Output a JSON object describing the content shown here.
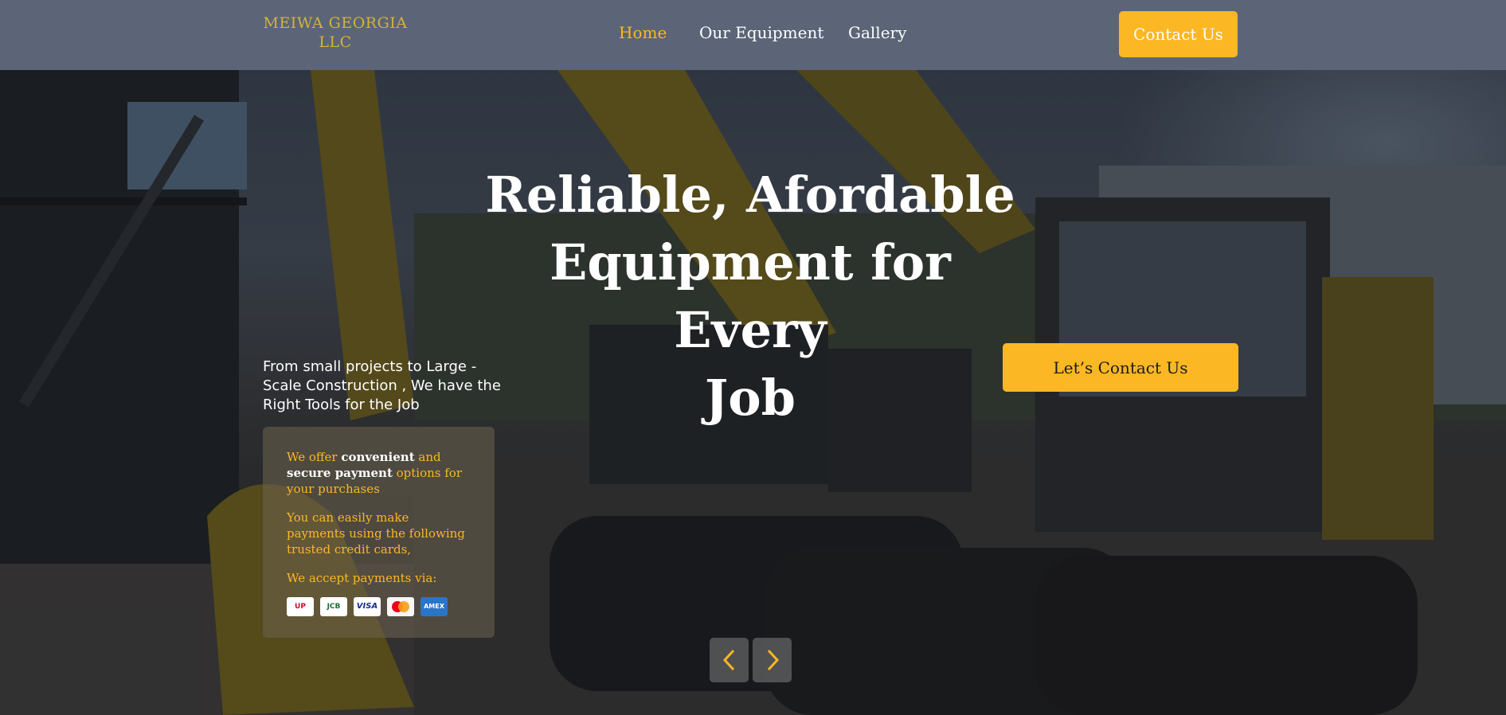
{
  "header": {
    "logo_line1": "MEIWA GEORGIA",
    "logo_line2": "LLC",
    "nav": [
      {
        "label": "Home",
        "active": true
      },
      {
        "label": "Our Equipment",
        "active": false
      },
      {
        "label": "Gallery",
        "active": false
      }
    ],
    "contact_button": "Contact Us"
  },
  "hero": {
    "title_line1": "Reliable, Afordable",
    "title_line2": "Equipment for Every",
    "title_line3": "Job",
    "subtitle_line1": "From small projects to Large -",
    "subtitle_line2": "Scale Construction , We have the",
    "subtitle_line3": "Right Tools for the Job",
    "cta_button": "Let’s Contact Us",
    "prev_icon": "chevron-left-icon",
    "next_icon": "chevron-right-icon"
  },
  "payment": {
    "p1_a": "We offer ",
    "p1_b": "convenient",
    "p1_c": " and",
    "p1_d": "secure payment",
    "p1_e": " options for",
    "p1_f": "your purchases",
    "p2_line1": "You can easily make",
    "p2_line2": "payments using the following",
    "p2_line3": "trusted credit cards,",
    "p3": "We accept payments via:",
    "cards": [
      "UnionPay",
      "JCB",
      "VISA",
      "Mastercard",
      "AMEX"
    ],
    "card_labels": {
      "unionpay": "UP",
      "jcb": "JCB",
      "visa": "VISA",
      "amex": "AMEX"
    }
  },
  "colors": {
    "accent": "#fbb724",
    "header_bg": "#5b6577",
    "logo": "#d4b23a"
  }
}
